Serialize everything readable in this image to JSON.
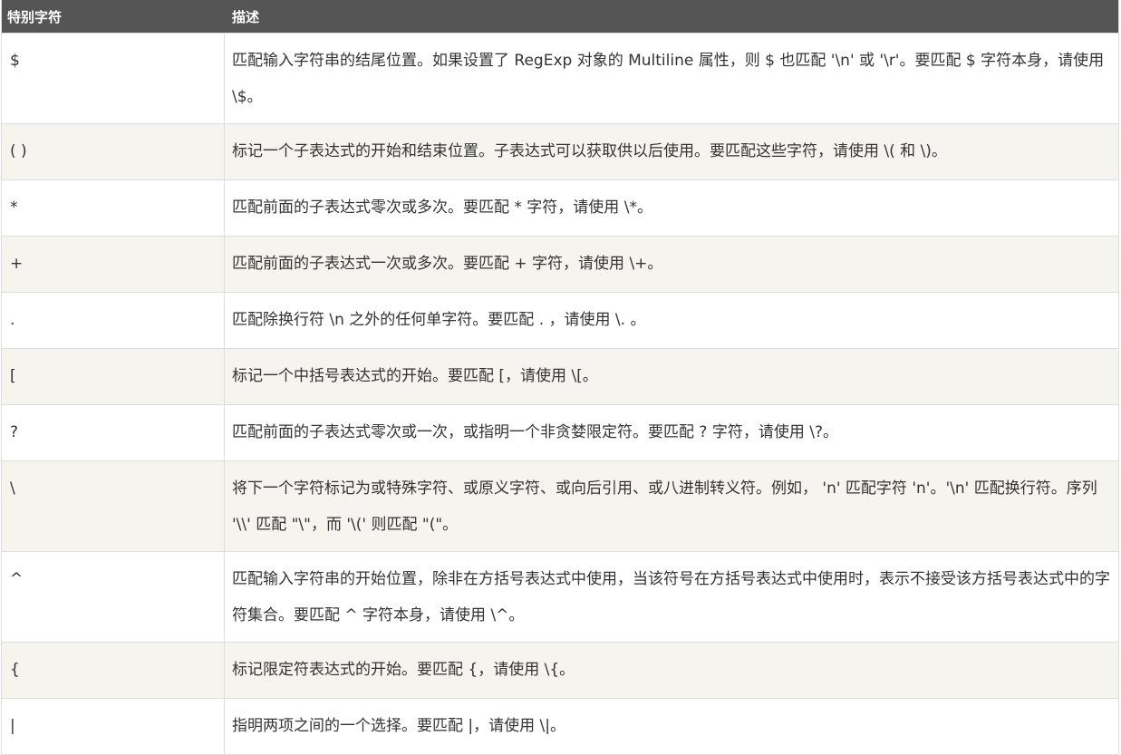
{
  "table": {
    "headers": {
      "symbol": "特别字符",
      "description": "描述"
    },
    "rows": [
      {
        "symbol": "$",
        "description": "匹配输入字符串的结尾位置。如果设置了 RegExp 对象的 Multiline 属性，则 $ 也匹配 '\\n' 或 '\\r'。要匹配 $ 字符本身，请使用 \\$。"
      },
      {
        "symbol": "( )",
        "description": "标记一个子表达式的开始和结束位置。子表达式可以获取供以后使用。要匹配这些字符，请使用 \\( 和 \\)。"
      },
      {
        "symbol": "*",
        "description": "匹配前面的子表达式零次或多次。要匹配 * 字符，请使用 \\*。"
      },
      {
        "symbol": "+",
        "description": "匹配前面的子表达式一次或多次。要匹配 + 字符，请使用 \\+。"
      },
      {
        "symbol": ".",
        "description": "匹配除换行符 \\n 之外的任何单字符。要匹配 . ，请使用 \\. 。"
      },
      {
        "symbol": "[",
        "description": "标记一个中括号表达式的开始。要匹配 [，请使用 \\[。"
      },
      {
        "symbol": "?",
        "description": "匹配前面的子表达式零次或一次，或指明一个非贪婪限定符。要匹配 ? 字符，请使用 \\?。"
      },
      {
        "symbol": "\\",
        "description": "将下一个字符标记为或特殊字符、或原义字符、或向后引用、或八进制转义符。例如， 'n' 匹配字符 'n'。'\\n' 匹配换行符。序列 '\\\\' 匹配 \"\\\"，而 '\\(' 则匹配 \"(\"。"
      },
      {
        "symbol": "^",
        "description": "匹配输入字符串的开始位置，除非在方括号表达式中使用，当该符号在方括号表达式中使用时，表示不接受该方括号表达式中的字符集合。要匹配 ^ 字符本身，请使用 \\^。"
      },
      {
        "symbol": "{",
        "description": "标记限定符表达式的开始。要匹配 {，请使用 \\{。"
      },
      {
        "symbol": "|",
        "description": "指明两项之间的一个选择。要匹配 |，请使用 \\|。"
      }
    ]
  },
  "colors": {
    "header_bg": "#555555",
    "header_text": "#ffffff",
    "alt_row_bg": "#f5f4ef",
    "border": "#dddddd",
    "body_text": "#333333"
  }
}
